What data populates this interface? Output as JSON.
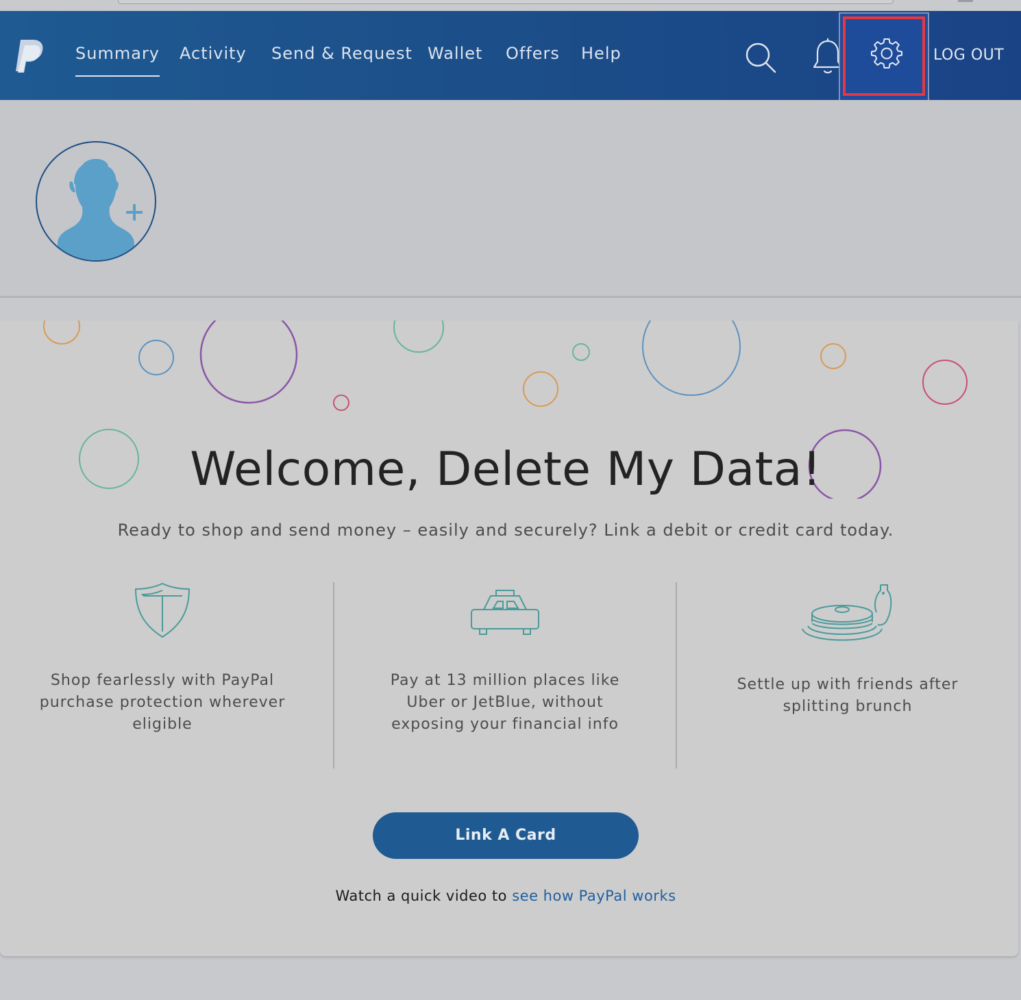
{
  "nav": {
    "items": [
      {
        "label": "Summary",
        "active": true
      },
      {
        "label": "Activity",
        "active": false
      },
      {
        "label": "Send & Request",
        "active": false
      },
      {
        "label": "Wallet",
        "active": false
      },
      {
        "label": "Offers",
        "active": false
      },
      {
        "label": "Help",
        "active": false
      }
    ],
    "logout_label": "LOG OUT",
    "icons": [
      "paypal-logo",
      "search-icon",
      "bell-icon",
      "gear-icon"
    ]
  },
  "welcome": {
    "title": "Welcome, Delete My Data!",
    "subtitle": "Ready to shop and send money – easily and securely? Link a debit or credit card today."
  },
  "features": [
    {
      "icon": "shield-icon",
      "text": "Shop fearlessly with PayPal purchase protection wherever eligible"
    },
    {
      "icon": "taxi-icon",
      "text": "Pay at 13 million places like Uber or JetBlue, without exposing your financial info"
    },
    {
      "icon": "pancakes-icon",
      "text": "Settle up with friends after splitting brunch"
    }
  ],
  "cta": {
    "button_label": "Link A Card",
    "video_prefix": "Watch a quick video to",
    "video_link": "see how PayPal works"
  },
  "colors": {
    "nav": "#1c4f89",
    "highlight": "#e53841",
    "button": "#1f5b92",
    "link": "#1f5fa1",
    "icon_teal": "#4a9b9a"
  }
}
